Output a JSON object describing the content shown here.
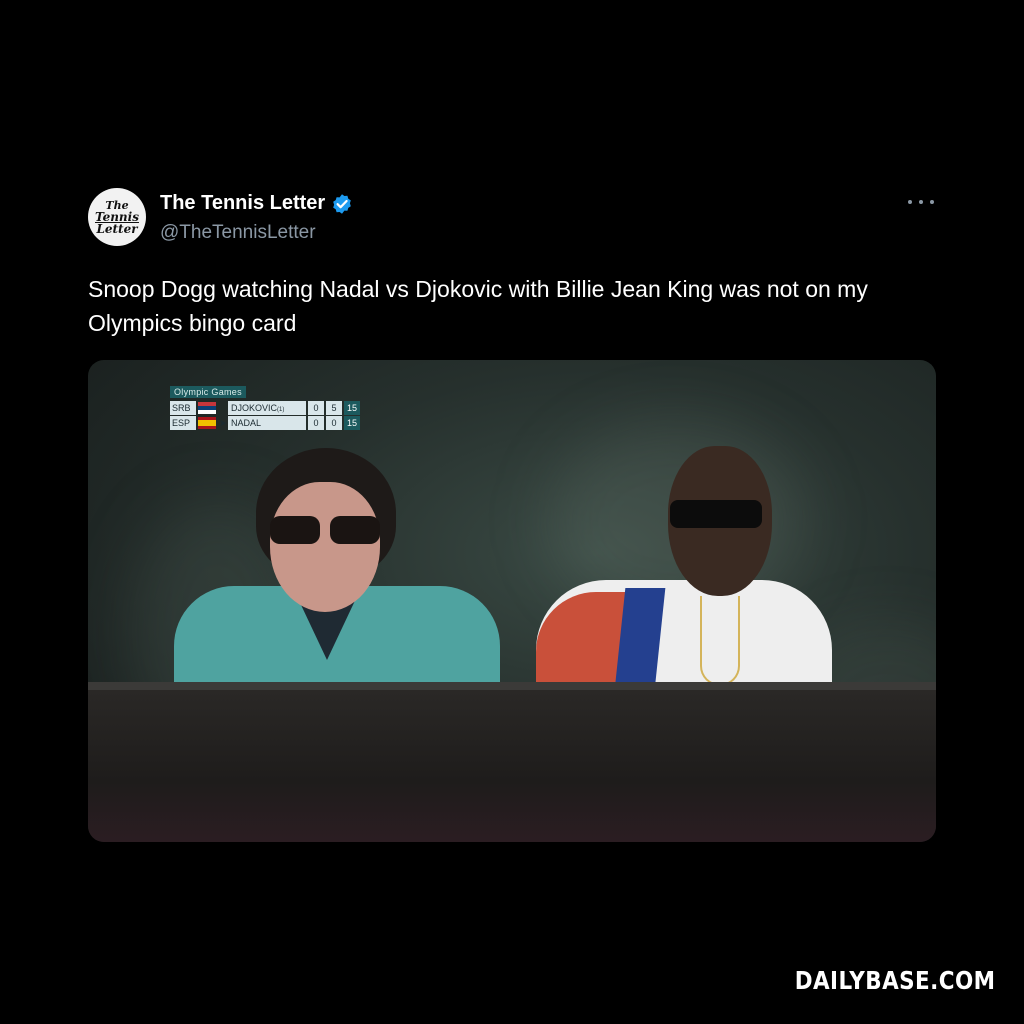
{
  "tweet": {
    "avatar": {
      "line1": "The",
      "line2": "Tennis",
      "line3": "Letter"
    },
    "display_name": "The Tennis Letter",
    "handle": "@TheTennisLetter",
    "verified": true,
    "text": "Snoop Dogg watching Nadal vs Djokovic with Billie Jean King was not on my Olympics bingo card"
  },
  "media": {
    "scoreboard": {
      "title": "Olympic Games",
      "rows": [
        {
          "code": "SRB",
          "serve": "",
          "name": "DJOKOVIC",
          "seed": "(1)",
          "sets": "0",
          "games": "5",
          "points": "15"
        },
        {
          "code": "ESP",
          "serve": "➤",
          "name": "NADAL",
          "seed": "",
          "sets": "0",
          "games": "0",
          "points": "15"
        }
      ]
    }
  },
  "footer": {
    "watermark": "DAILYBASE.COM"
  },
  "colors": {
    "background": "#000000",
    "verified": "#1d9bf0",
    "scoreboard_accent": "#1c5a5e"
  },
  "icons": {
    "verified": "verified-badge-icon",
    "more": "more-horizontal-icon"
  }
}
